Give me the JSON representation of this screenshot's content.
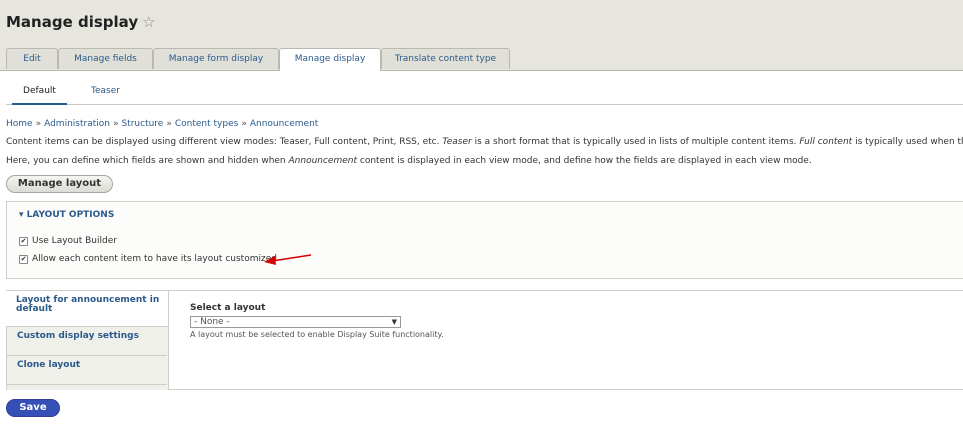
{
  "page": {
    "title": "Manage display",
    "star_glyph": "☆"
  },
  "tabs": [
    {
      "label": "Edit"
    },
    {
      "label": "Manage fields"
    },
    {
      "label": "Manage form display"
    },
    {
      "label": "Manage display",
      "active": true
    },
    {
      "label": "Translate content type"
    }
  ],
  "subtabs": [
    {
      "label": "Default",
      "active": true
    },
    {
      "label": "Teaser"
    }
  ],
  "breadcrumb": {
    "items": [
      "Home",
      "Administration",
      "Structure",
      "Content types",
      "Announcement"
    ],
    "separator": "»"
  },
  "description": {
    "line1": {
      "a": "Content items can be displayed using different view modes: Teaser, Full content, Print, RSS, etc. ",
      "b": "Teaser",
      "c": " is a short format that is typically used in lists of multiple content items. ",
      "d": "Full content",
      "e": " is typically used when the conte"
    },
    "line2": {
      "a": "Here, you can define which fields are shown and hidden when ",
      "b": "Announcement",
      "c": " content is displayed in each view mode, and define how the fields are displayed in each view mode."
    }
  },
  "buttons": {
    "manage_layout": "Manage layout",
    "save": "Save"
  },
  "layout_options": {
    "legend": "▾ LAYOUT OPTIONS",
    "use_layout_builder": {
      "label": "Use Layout Builder",
      "checked": true
    },
    "allow_customize": {
      "label": "Allow each content item to have its layout customized",
      "checked": true
    },
    "check_glyph": "✔"
  },
  "vertical_tabs": [
    {
      "label": "Layout for announcement in default",
      "active": true
    },
    {
      "label": "Custom display settings"
    },
    {
      "label": "Clone layout"
    }
  ],
  "layout_pane": {
    "label": "Select a layout",
    "selected": "- None -",
    "help": "A layout must be selected to enable Display Suite functionality."
  },
  "colors": {
    "accent": "#2b5b8b",
    "save_button": "#3650b8",
    "annotation_arrow": "#d40000"
  }
}
